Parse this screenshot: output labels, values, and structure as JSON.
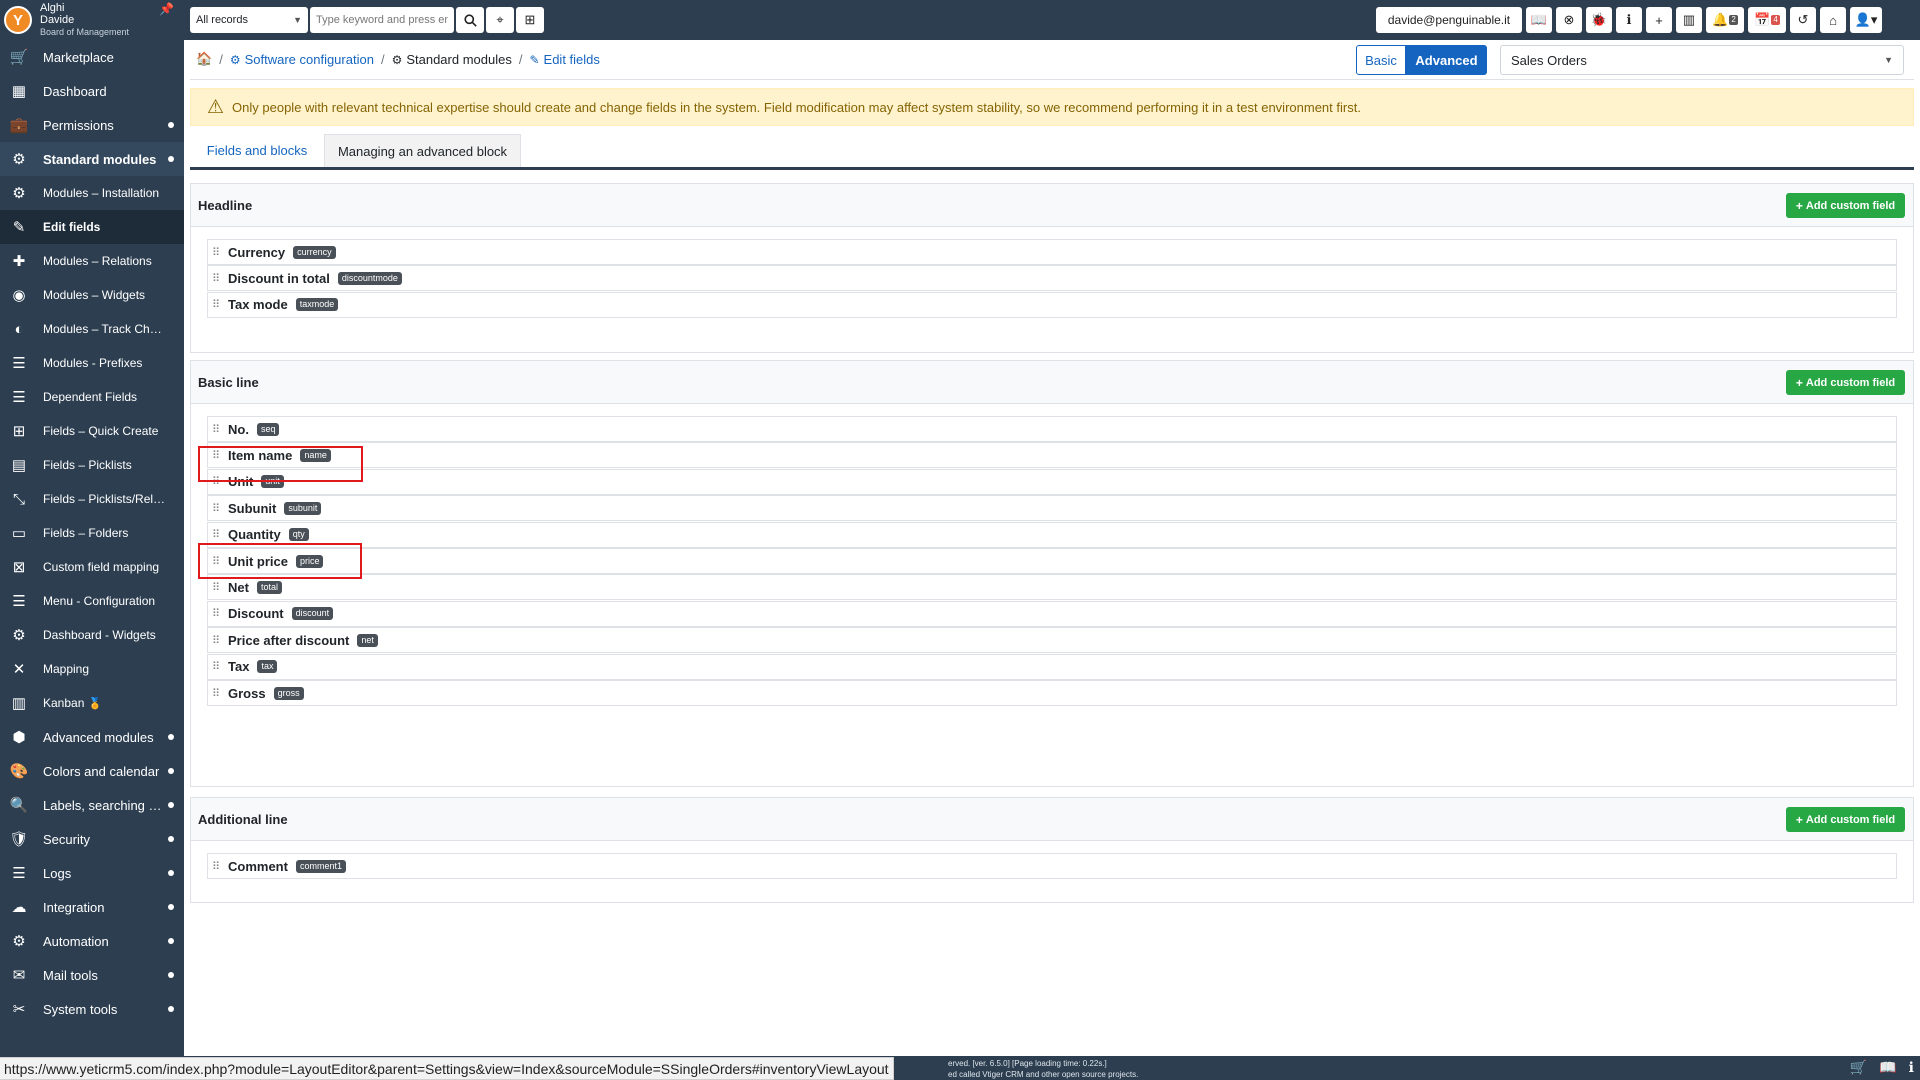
{
  "user": {
    "line1": "Alghi",
    "line2": "Davide",
    "line3": "Board of Management"
  },
  "sidebar": {
    "items": [
      {
        "label": "Marketplace",
        "icon": "cart-icon",
        "glyph": "🛒"
      },
      {
        "label": "Dashboard",
        "icon": "dashboard-icon",
        "glyph": "▦"
      },
      {
        "label": "Permissions",
        "icon": "briefcase-icon",
        "glyph": "💼",
        "dot": true
      },
      {
        "label": "Standard modules",
        "icon": "modules-icon",
        "glyph": "⚙",
        "dot": true,
        "parent": true
      },
      {
        "label": "Modules – Installation",
        "icon": "modules-install-icon",
        "glyph": "⚙",
        "sub": true
      },
      {
        "label": "Edit fields",
        "icon": "edit-fields-icon",
        "glyph": "✎",
        "sub": true,
        "active": true
      },
      {
        "label": "Modules – Relations",
        "icon": "puzzle-icon",
        "glyph": "✚",
        "sub": true
      },
      {
        "label": "Modules – Widgets",
        "icon": "widgets-icon",
        "glyph": "◉",
        "sub": true
      },
      {
        "label": "Modules – Track Changes",
        "icon": "track-changes-icon",
        "glyph": "◐",
        "sub": true
      },
      {
        "label": "Modules - Prefixes",
        "icon": "prefixes-icon",
        "glyph": "☰",
        "sub": true
      },
      {
        "label": "Dependent Fields",
        "icon": "list-icon",
        "glyph": "☰",
        "sub": true
      },
      {
        "label": "Fields – Quick Create",
        "icon": "plus-square-icon",
        "glyph": "⊞",
        "sub": true
      },
      {
        "label": "Fields – Picklists",
        "icon": "picklist-icon",
        "glyph": "▤",
        "sub": true
      },
      {
        "label": "Fields – Picklists/Relations",
        "icon": "picklist-relations-icon",
        "glyph": "⤡",
        "sub": true
      },
      {
        "label": "Fields – Folders",
        "icon": "folders-icon",
        "glyph": "▭",
        "sub": true
      },
      {
        "label": "Custom field mapping",
        "icon": "mapping-icon",
        "glyph": "⊠",
        "sub": true
      },
      {
        "label": "Menu - Configuration",
        "icon": "menu-icon",
        "glyph": "☰",
        "sub": true
      },
      {
        "label": "Dashboard - Widgets",
        "icon": "dashboard-widgets-icon",
        "glyph": "⚙",
        "sub": true
      },
      {
        "label": "Mapping",
        "icon": "arrows-icon",
        "glyph": "✕",
        "sub": true
      },
      {
        "label": "Kanban",
        "icon": "kanban-icon",
        "glyph": "▥",
        "sub": true,
        "extra": "🏅"
      },
      {
        "label": "Advanced modules",
        "icon": "cubes-icon",
        "glyph": "⬢",
        "dot": true
      },
      {
        "label": "Colors and calendar",
        "icon": "palette-icon",
        "glyph": "🎨",
        "dot": true
      },
      {
        "label": "Labels, searching and...",
        "icon": "search-lang-icon",
        "glyph": "🔍",
        "dot": true
      },
      {
        "label": "Security",
        "icon": "shield-icon",
        "glyph": "🛡",
        "dot": true
      },
      {
        "label": "Logs",
        "icon": "logs-icon",
        "glyph": "☰",
        "dot": true
      },
      {
        "label": "Integration",
        "icon": "cloud-icon",
        "glyph": "☁",
        "dot": true
      },
      {
        "label": "Automation",
        "icon": "gears-icon",
        "glyph": "⚙",
        "dot": true
      },
      {
        "label": "Mail tools",
        "icon": "mail-icon",
        "glyph": "✉",
        "dot": true
      },
      {
        "label": "System tools",
        "icon": "tools-icon",
        "glyph": "✂",
        "dot": true
      }
    ]
  },
  "topbar": {
    "records_select": "All records",
    "search_placeholder": "Type keyword and press enter",
    "email": "davide@penguinable.it",
    "notifications_count": "2",
    "calendar_count": "4"
  },
  "breadcrumb": {
    "software_configuration": "Software configuration",
    "standard_modules": "Standard modules",
    "edit_fields": "Edit fields"
  },
  "mode": {
    "basic": "Basic",
    "advanced": "Advanced"
  },
  "module_select": "Sales Orders",
  "warning": "Only people with relevant technical expertise should create and change fields in the system. Field modification may affect system stability, so we recommend performing it in a test environment first.",
  "tabs": {
    "fields_blocks": "Fields and blocks",
    "managing_block": "Managing an advanced block"
  },
  "add_custom_field": "Add custom field",
  "blocks": [
    {
      "title": "Headline",
      "fields": [
        {
          "label": "Currency",
          "tag": "currency"
        },
        {
          "label": "Discount in total",
          "tag": "discountmode"
        },
        {
          "label": "Tax mode",
          "tag": "taxmode"
        }
      ]
    },
    {
      "title": "Basic line",
      "fields": [
        {
          "label": "No.",
          "tag": "seq"
        },
        {
          "label": "Item name",
          "tag": "name"
        },
        {
          "label": "Unit",
          "tag": "unit"
        },
        {
          "label": "Subunit",
          "tag": "subunit"
        },
        {
          "label": "Quantity",
          "tag": "qty"
        },
        {
          "label": "Unit price",
          "tag": "price"
        },
        {
          "label": "Net",
          "tag": "total"
        },
        {
          "label": "Discount",
          "tag": "discount"
        },
        {
          "label": "Price after discount",
          "tag": "net"
        },
        {
          "label": "Tax",
          "tag": "tax"
        },
        {
          "label": "Gross",
          "tag": "gross"
        }
      ]
    },
    {
      "title": "Additional line",
      "fields": [
        {
          "label": "Comment",
          "tag": "comment1"
        }
      ]
    }
  ],
  "status_url": "https://www.yeticrm5.com/index.php?module=LayoutEditor&parent=Settings&view=Index&sourceModule=SSingleOrders#inventoryViewLayout",
  "footer": {
    "line1": "erved. [ver. 6.5.0] [Page loading time: 0.22s.]",
    "line2": "ed called Vtiger CRM and other open source projects."
  }
}
